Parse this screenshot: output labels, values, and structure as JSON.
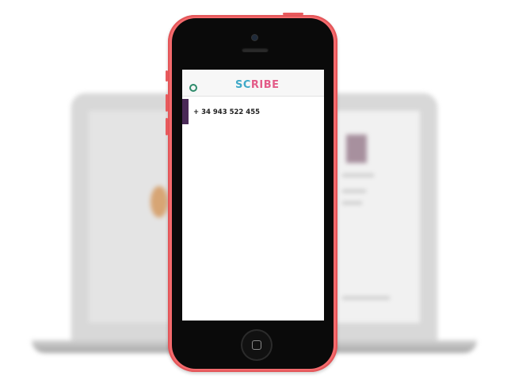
{
  "app": {
    "logo_part1": "SC",
    "logo_part2": "RIBE",
    "phone_number": "+ 34 943 522 455"
  },
  "colors": {
    "phone_shell": "#f46a6d",
    "logo_blue": "#3fa9c8",
    "logo_pink": "#e35b88",
    "side_tab": "#4a2a57",
    "menu_dot": "#2e8b6b"
  },
  "icons": {
    "menu": "circle-menu-icon",
    "home": "home-button-icon",
    "camera": "camera-icon",
    "speaker": "speaker-icon"
  }
}
